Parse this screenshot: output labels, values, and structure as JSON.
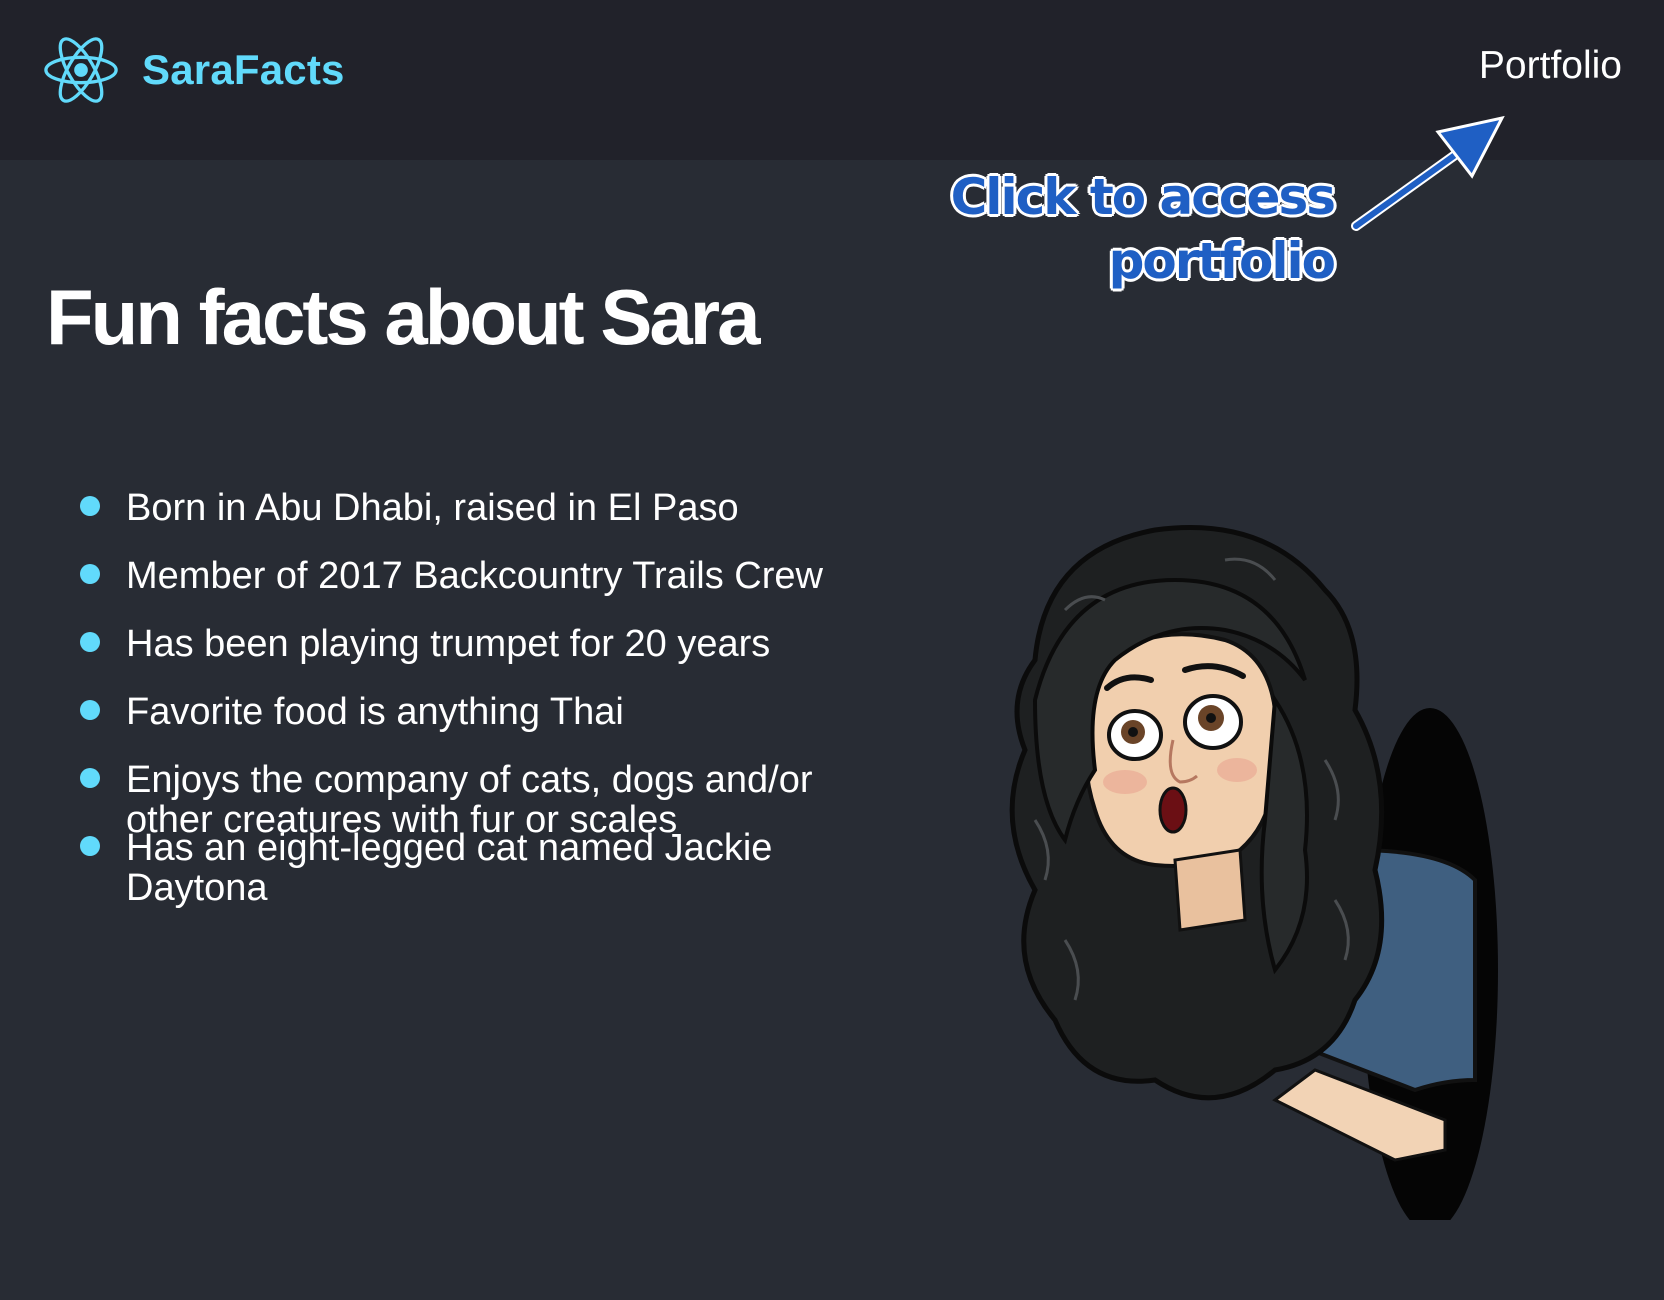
{
  "navbar": {
    "brand_name": "SaraFacts",
    "brand_icon": "react-logo-icon",
    "nav_link": "Portfolio"
  },
  "callout": {
    "line1": "Click to access",
    "line2": "portfolio",
    "arrow_icon": "arrow-up-right-icon"
  },
  "main": {
    "title": "Fun facts about Sara",
    "facts": [
      "Born in Abu Dhabi, raised in El Paso",
      "Member of 2017 Backcountry Trails Crew",
      "Has been playing trumpet for 20 years",
      "Favorite food is anything Thai",
      "Enjoys the company of cats, dogs and/or other creatures with fur or scales",
      "Has an eight-legged cat named Jackie Daytona"
    ],
    "image": "bitmoji-avatar"
  },
  "colors": {
    "background": "#282c34",
    "navbar": "#21222a",
    "accent": "#61dafb",
    "callout": "#1f5fc4"
  }
}
